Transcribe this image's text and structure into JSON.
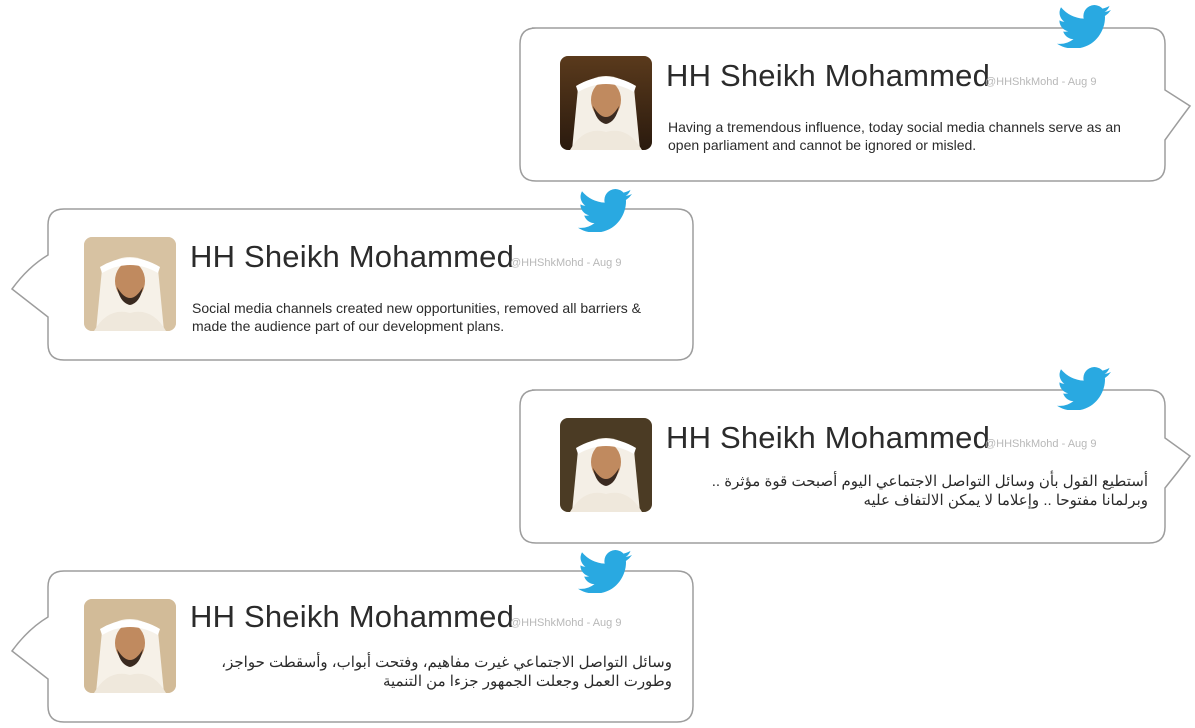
{
  "accent_color": "#29a9e1",
  "bubble_border_color": "#9d9d9d",
  "tweets": [
    {
      "name": "HH Sheikh Mohammed",
      "handle": "@HHShkMohd - Aug 9",
      "text": "Having a tremendous influence, today social media channels serve as an open parliament and cannot be ignored or misled.",
      "direction": "ltr",
      "icon": "twitter-bird-icon"
    },
    {
      "name": "HH Sheikh Mohammed",
      "handle": "@HHShkMohd - Aug 9",
      "text": "Social media channels created new opportunities, removed all barriers & made the audience part of our development plans.",
      "direction": "ltr",
      "icon": "twitter-bird-icon"
    },
    {
      "name": "HH Sheikh Mohammed",
      "handle": "@HHShkMohd - Aug 9",
      "text": "أستطيع القول بأن وسائل التواصل الاجتماعي اليوم أصبحت قوة مؤثرة .. وبرلمانا مفتوحا .. وإعلاما لا يمكن الالتفاف عليه",
      "direction": "rtl",
      "icon": "twitter-bird-icon"
    },
    {
      "name": "HH Sheikh Mohammed",
      "handle": "@HHShkMohd - Aug 9",
      "text": "وسائل التواصل الاجتماعي غيرت مفاهيم، وفتحت أبواب، وأسقطت حواجز، وطورت العمل وجعلت الجمهور جزءا من التنمية",
      "direction": "rtl",
      "icon": "twitter-bird-icon"
    }
  ]
}
